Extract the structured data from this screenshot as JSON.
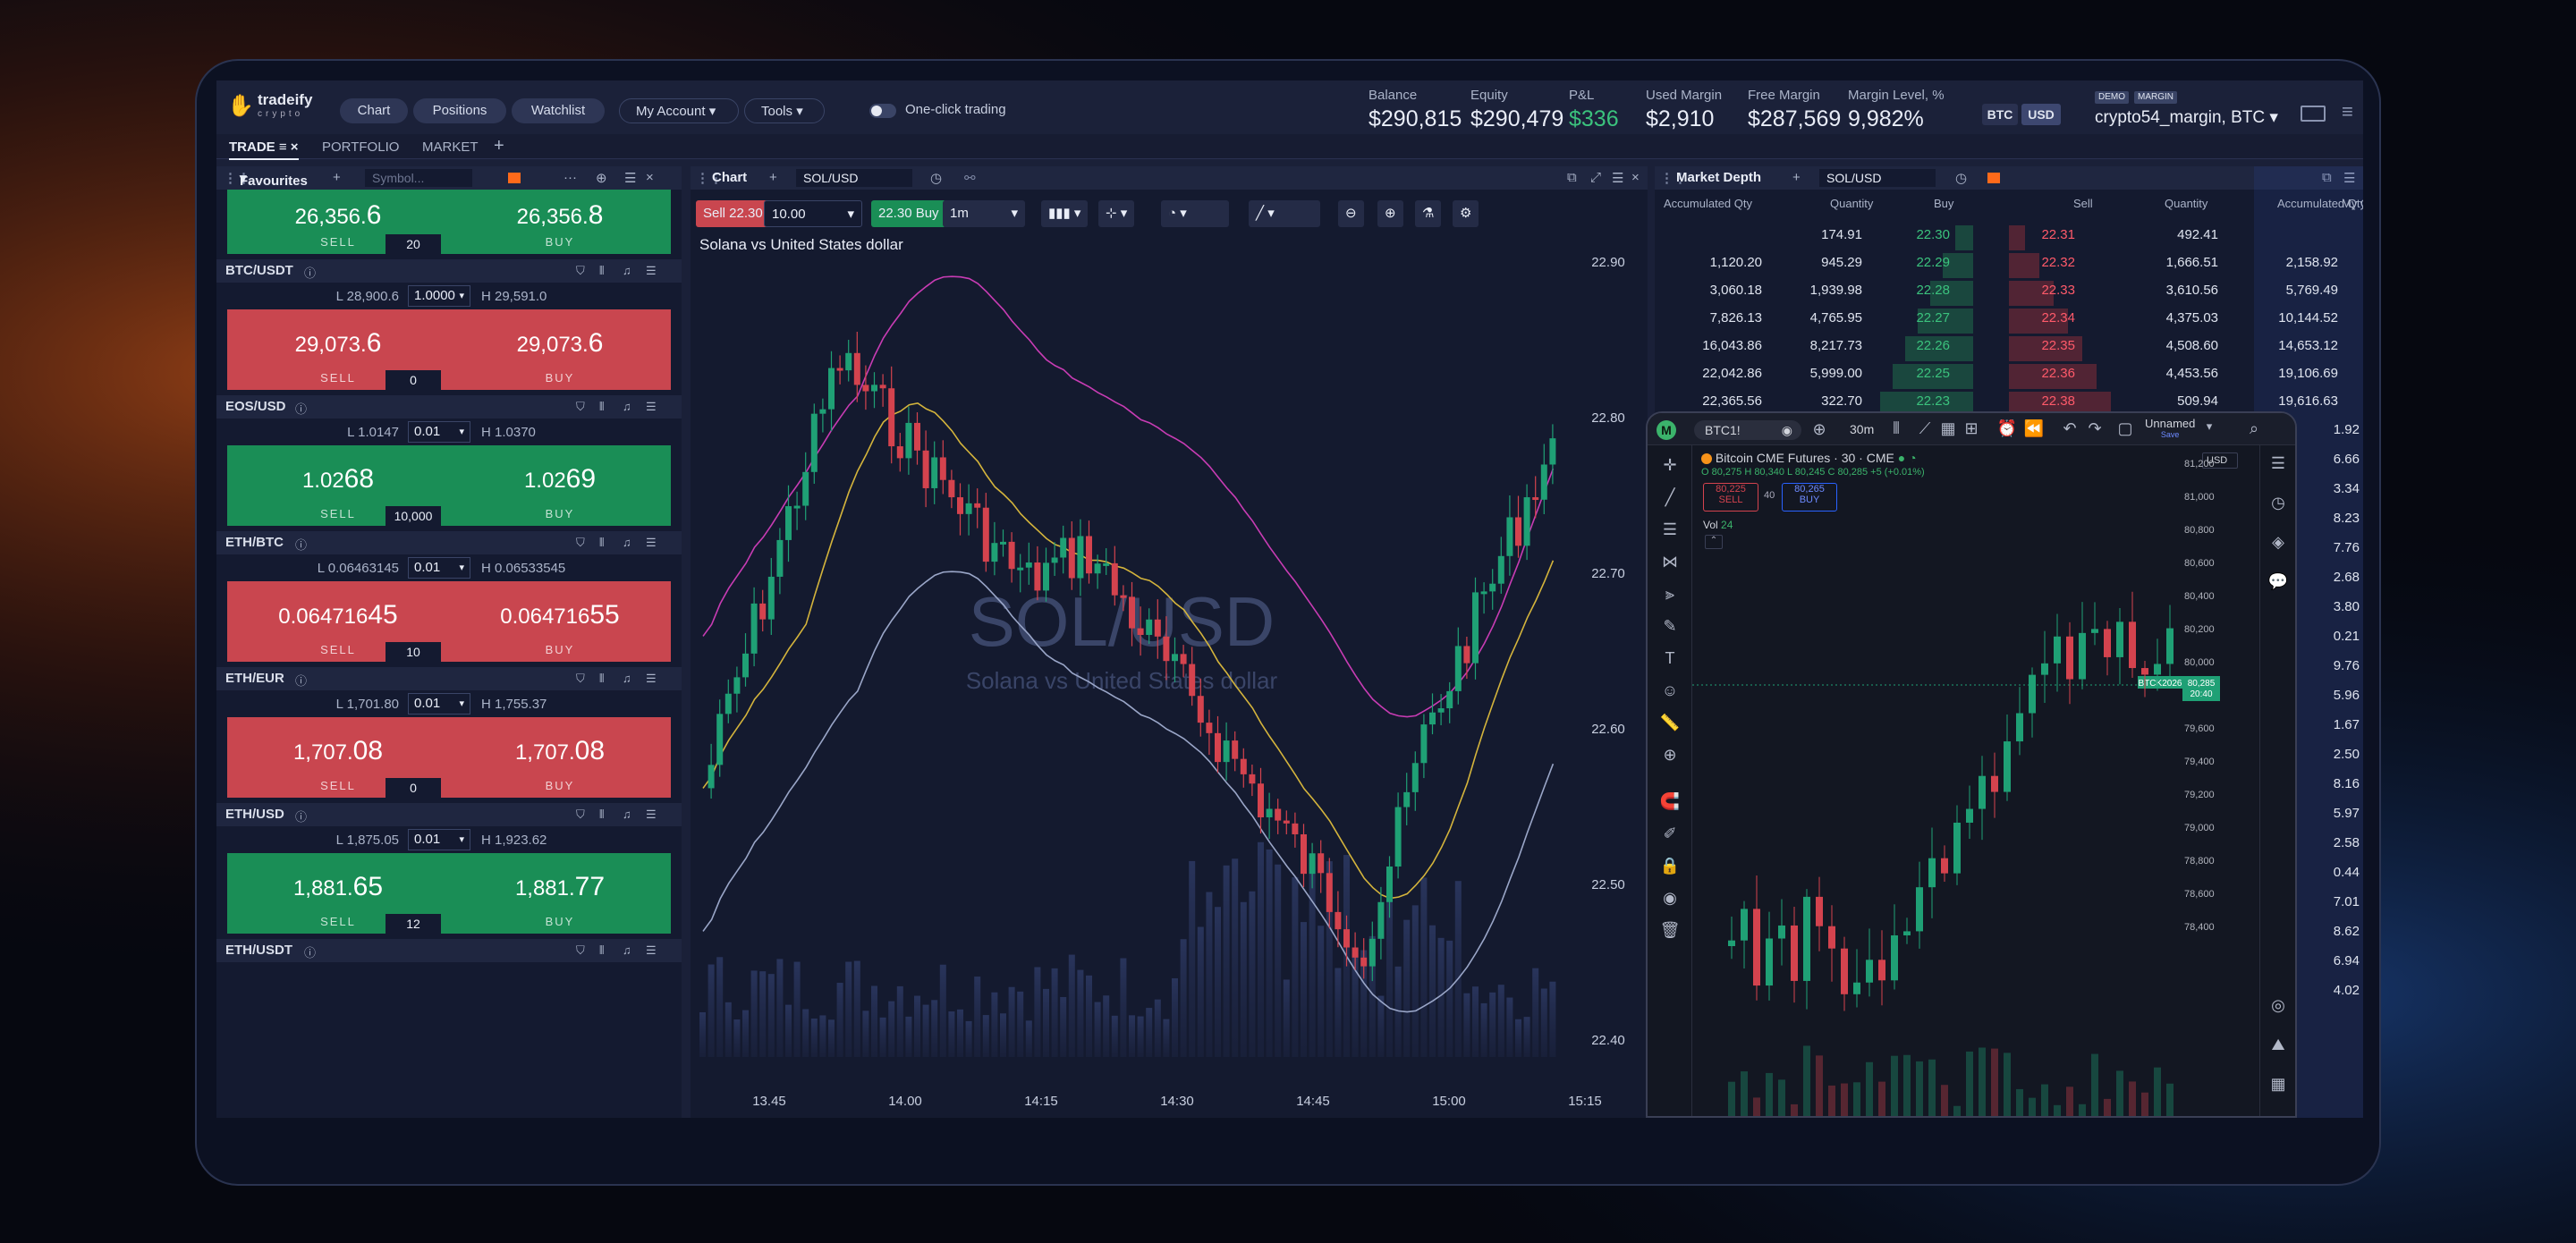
{
  "app": {
    "logo": "tradeify",
    "logo_sub": "crypto",
    "top_tabs": [
      "Chart",
      "Positions",
      "Watchlist"
    ],
    "my_account": "My Account",
    "tools": "Tools",
    "one_click": "One-click trading",
    "currencies": [
      "BTC",
      "USD"
    ],
    "demo_tag": "DEMO",
    "margin_tag": "MARGIN",
    "account": "crypto54_margin, BTC"
  },
  "metrics": [
    {
      "label": "Balance",
      "value": "$290,815"
    },
    {
      "label": "Equity",
      "value": "$290,479"
    },
    {
      "label": "P&L",
      "value": "$336"
    },
    {
      "label": "Used Margin",
      "value": "$2,910"
    },
    {
      "label": "Free Margin",
      "value": "$287,569"
    },
    {
      "label": "Margin Level, %",
      "value": "9,982%"
    }
  ],
  "nav": [
    "TRADE",
    "PORTFOLIO",
    "MARKET"
  ],
  "favourites": {
    "title": "Favourites",
    "search_placeholder": "Symbol...",
    "sell_label": "SELL",
    "buy_label": "BUY",
    "instruments": [
      {
        "symbol": "",
        "low": "",
        "high": "",
        "lot": "",
        "sell": "26,356.",
        "sell_big": "6",
        "buy": "26,356.",
        "buy_big": "8",
        "qty": "20",
        "color": "grn"
      },
      {
        "symbol": "BTC/USDT",
        "low": "L 28,900.6",
        "high": "H 29,591.0",
        "lot": "1.0000",
        "sell": "29,073.",
        "sell_big": "6",
        "buy": "29,073.",
        "buy_big": "6",
        "qty": "0",
        "color": "red"
      },
      {
        "symbol": "EOS/USD",
        "low": "L 1.0147",
        "high": "H 1.0370",
        "lot": "0.01",
        "sell": "1.02",
        "sell_big": "68",
        "buy": "1.02",
        "buy_big": "69",
        "qty": "10,000",
        "color": "grn"
      },
      {
        "symbol": "ETH/BTC",
        "low": "L 0.06463145",
        "high": "H 0.06533545",
        "lot": "0.01",
        "sell": "0.064716",
        "sell_big": "45",
        "buy": "0.064716",
        "buy_big": "55",
        "qty": "10",
        "color": "red"
      },
      {
        "symbol": "ETH/EUR",
        "low": "L 1,701.80",
        "high": "H 1,755.37",
        "lot": "0.01",
        "sell": "1,707.",
        "sell_big": "08",
        "buy": "1,707.",
        "buy_big": "08",
        "qty": "0",
        "color": "red"
      },
      {
        "symbol": "ETH/USD",
        "low": "L 1,875.05",
        "high": "H 1,923.62",
        "lot": "0.01",
        "sell": "1,881.",
        "sell_big": "65",
        "buy": "1,881.",
        "buy_big": "77",
        "qty": "12",
        "color": "grn"
      },
      {
        "symbol": "ETH/USDT",
        "low": "",
        "high": "",
        "lot": "",
        "sell": "",
        "sell_big": "",
        "buy": "",
        "buy_big": "",
        "qty": "",
        "color": "none"
      }
    ]
  },
  "chart": {
    "title": "Chart",
    "symbol": "SOL/USD",
    "sell_btn": "Sell 22.30",
    "qty": "10.00",
    "buy_btn": "22.30 Buy",
    "interval": "1m",
    "description": "Solana vs United States dollar",
    "watermark": "SOL/USD",
    "watermark_sub": "Solana vs United States dollar",
    "y_ticks": [
      "22.90",
      "22.80",
      "22.70",
      "22.60",
      "22.50",
      "22.40"
    ],
    "x_ticks": [
      "13.45",
      "14.00",
      "14:15",
      "14:30",
      "14:45",
      "15:00",
      "15:15"
    ]
  },
  "depth": {
    "title": "Market Depth",
    "symbol": "SOL/USD",
    "headers": [
      "Accumulated Qty",
      "Quantity",
      "Buy",
      "Sell",
      "Quantity",
      "Accumulated Qty",
      "My O"
    ],
    "rows": [
      [
        "",
        "174.91",
        "22.30",
        "22.31",
        "492.41",
        ""
      ],
      [
        "1,120.20",
        "945.29",
        "22.29",
        "22.32",
        "1,666.51",
        "2,158.92"
      ],
      [
        "3,060.18",
        "1,939.98",
        "22.28",
        "22.33",
        "3,610.56",
        "5,769.49"
      ],
      [
        "7,826.13",
        "4,765.95",
        "22.27",
        "22.34",
        "4,375.03",
        "10,144.52"
      ],
      [
        "16,043.86",
        "8,217.73",
        "22.26",
        "22.35",
        "4,508.60",
        "14,653.12"
      ],
      [
        "22,042.86",
        "5,999.00",
        "22.25",
        "22.36",
        "4,453.56",
        "19,106.69"
      ],
      [
        "22,365.56",
        "322.70",
        "22.23",
        "22.38",
        "509.94",
        "19,616.63"
      ]
    ],
    "partial_right": [
      "1.92",
      "6.66",
      "3.34",
      "8.23",
      "7.76",
      "2.68",
      "3.80",
      "0.21",
      "9.76",
      "5.96",
      "1.67",
      "2.50",
      "8.16",
      "5.97",
      "2.58",
      "0.44",
      "7.01",
      "8.62",
      "6.94",
      "4.02"
    ]
  },
  "tv": {
    "symbol": "BTC1!",
    "interval": "30m",
    "layout": "Unnamed",
    "layout_sub": "Save",
    "title": "Bitcoin CME Futures · 30 · CME",
    "ohlc": "O 80,275  H 80,340  L 80,245  C 80,285 +5 (+0.01%)",
    "sell_price": "80,225",
    "sell_label": "SELL",
    "spread": "40",
    "buy_price": "80,265",
    "buy_label": "BUY",
    "vol_label": "Vol",
    "vol_value": "24",
    "currency": "USD",
    "price_tag": "BTCK2026",
    "price_tag_value": "80,285",
    "price_tag_time": "20:40",
    "y_ticks": [
      "81,200",
      "81,000",
      "80,800",
      "80,600",
      "80,400",
      "80,200",
      "80,000",
      "79,800",
      "79,600",
      "79,400",
      "79,200",
      "79,000",
      "78,800",
      "78,600",
      "78,400"
    ]
  },
  "colors": {
    "up": "#1fa075",
    "down": "#d4434e",
    "accent": "#ff6a1a"
  }
}
